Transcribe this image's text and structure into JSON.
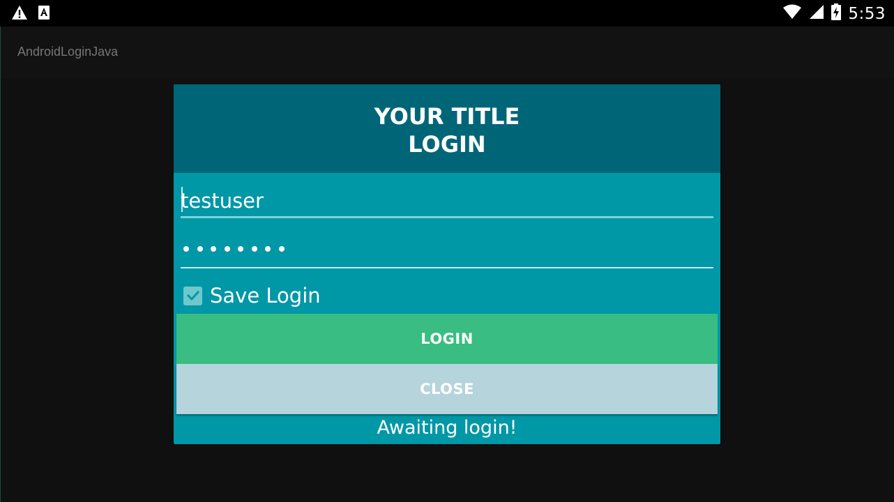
{
  "status_bar": {
    "time": "5:53",
    "left_icons": [
      "warning-icon",
      "notification-a-icon"
    ],
    "right_icons": [
      "wifi-icon",
      "signal-icon",
      "battery-charging-icon"
    ]
  },
  "app_bar": {
    "title": "AndroidLoginJava"
  },
  "dialog": {
    "title_line1": "YOUR TITLE",
    "title_line2": "LOGIN",
    "username_value": "testuser",
    "password_masked": "••••••••",
    "password_length": 8,
    "save_login_label": "Save Login",
    "save_login_checked": true,
    "login_button": "LOGIN",
    "close_button": "CLOSE",
    "status_message": "Awaiting login!"
  },
  "colors": {
    "header": "#006677",
    "dialog_body": "#0097a7",
    "login_button": "#39bd82",
    "close_button": "#b5d4db",
    "checkbox": "#6fc8cc"
  }
}
